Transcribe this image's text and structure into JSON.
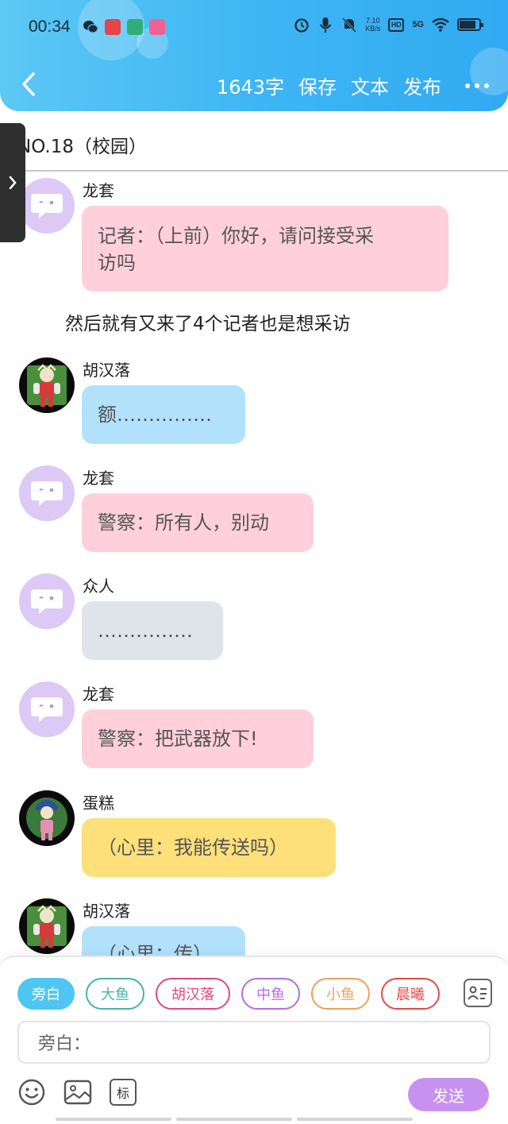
{
  "status_bar": {
    "time": "00:34",
    "net_speed_value": "7.10",
    "net_speed_unit": "KB/s",
    "hd_label": "HD",
    "network_label": "5G",
    "battery_level": 0.85
  },
  "header": {
    "word_count": "1643字",
    "save_label": "保存",
    "text_label": "文本",
    "publish_label": "发布"
  },
  "chapter_title": "NO.18（校园）",
  "narration": "然后就有又来了4个记者也是想采访",
  "messages": [
    {
      "sender": "龙套",
      "text": "记者：（上前）你好，请问接受采访吗",
      "line1": "记者：（上前）你好，请问接受采",
      "line2": "访吗",
      "color": "#ffd0dc"
    },
    {
      "sender": "胡汉落",
      "text": "额……………",
      "color": "#b2e1fb"
    },
    {
      "sender": "龙套",
      "text": "警察：所有人，别动",
      "color": "#ffd0dc"
    },
    {
      "sender": "众人",
      "text": "……………",
      "color": "#dfe4ea"
    },
    {
      "sender": "龙套",
      "text": "警察：把武器放下!",
      "color": "#ffd0dc"
    },
    {
      "sender": "蛋糕",
      "text": "（心里：我能传送吗）",
      "color": "#fde07a"
    },
    {
      "sender": "胡汉落",
      "text": "（心里：传）",
      "color": "#b2e1fb"
    }
  ],
  "role_chips": [
    {
      "label": "旁白",
      "color": "#4fc6f2",
      "selected": true
    },
    {
      "label": "大鱼",
      "color": "#47b3a7",
      "selected": false
    },
    {
      "label": "胡汉落",
      "color": "#e2477f",
      "selected": false
    },
    {
      "label": "中鱼",
      "color": "#b46ee3",
      "selected": false
    },
    {
      "label": "小鱼",
      "color": "#f0a05c",
      "selected": false
    },
    {
      "label": "晨曦",
      "color": "#e24b4b",
      "selected": false
    }
  ],
  "input": {
    "placeholder": "旁白："
  },
  "tools": {
    "tag_label": "标",
    "send_label": "发送"
  }
}
